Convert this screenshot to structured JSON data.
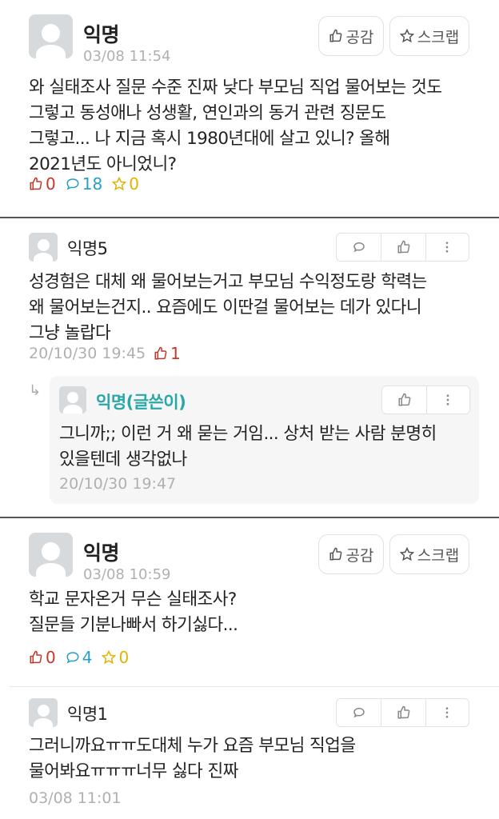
{
  "posts": [
    {
      "author": "익명",
      "time": "03/08 11:54",
      "content": "와 실태조사 질문 수준 진짜 낮다 부모님 직업 물어보는 것도\n그렇고 동성애나 성생활, 연인과의 동거 관련 징문도\n그렇고... 나 지금 혹시 1980년대에 살고 있니? 올해\n2021년도 아니었니?",
      "like_btn": "공감",
      "scrap_btn": "스크랩",
      "likes": "0",
      "comments": "18",
      "scraps": "0"
    },
    {
      "author": "익명",
      "time": "03/08 10:59",
      "content": "학교 문자온거 무슨 실태조사?\n질문들 기분나빠서 하기싫다...",
      "like_btn": "공감",
      "scrap_btn": "스크랩",
      "likes": "0",
      "comments": "4",
      "scraps": "0"
    }
  ],
  "comments": [
    {
      "author": "익명5",
      "content": "성경험은 대체 왜 물어보는거고 부모님 수익정도랑 학력는\n왜 물어보는건지.. 요즘에도 이딴걸 물어보는 데가 있다니\n그냥 놀랍다",
      "time": "20/10/30 19:45",
      "likes": "1"
    },
    {
      "author": "익명1",
      "content": "그러니까요ㅠㅠ도대체 누가 요즘 부모님 직업을\n물어봐요ㅠㅠㅠ너무 싫다 진짜",
      "time": "03/08 11:01"
    }
  ],
  "reply": {
    "arrow": "↳",
    "author": "익명(글쓴이)",
    "content": "그니까;; 이런 거 왜 묻는 거임... 상처 받는 사람 분명히\n있을텐데 생각없나",
    "time": "20/10/30 19:47"
  },
  "icons": {
    "thumb": "thumbs-up-icon",
    "star": "star-icon",
    "comment": "comment-icon",
    "more": "more-vertical-icon"
  },
  "colors": {
    "like": "#c0392b",
    "comment": "#2a9fc4",
    "star": "#e0b400",
    "op_name": "#2aa7a7"
  }
}
